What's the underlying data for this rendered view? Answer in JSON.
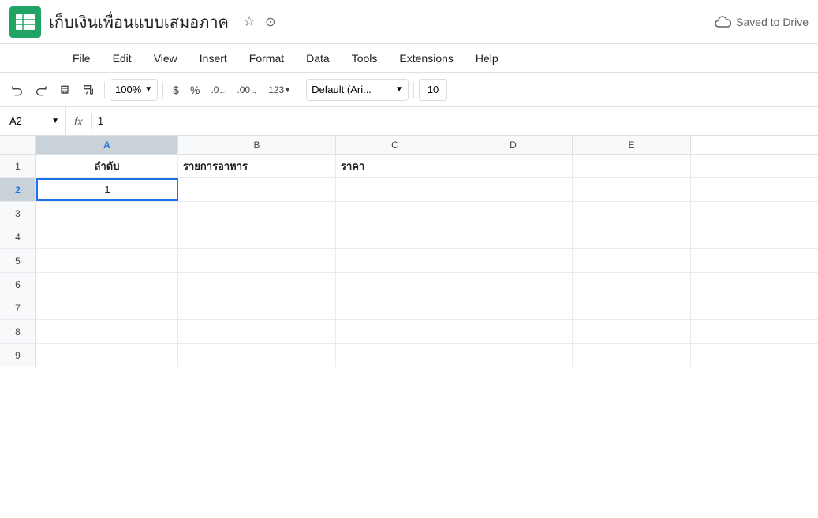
{
  "titleBar": {
    "docTitle": "เก็บเงินเพื่อนแบบเสมอภาค",
    "savedStatus": "Saved to Drive"
  },
  "menuBar": {
    "items": [
      "File",
      "Edit",
      "View",
      "Insert",
      "Format",
      "Data",
      "Tools",
      "Extensions",
      "Help"
    ]
  },
  "toolbar": {
    "zoomLevel": "100%",
    "dollarSign": "$",
    "percentSign": "%",
    "decimal0": ".0",
    "decimal00": ".00",
    "moreFormats": "123",
    "fontFamily": "Default (Ari...",
    "fontSize": "10"
  },
  "formulaBar": {
    "cellRef": "A2",
    "fxLabel": "fx",
    "formula": "1"
  },
  "columns": [
    "A",
    "B",
    "C",
    "D",
    "E"
  ],
  "rows": [
    {
      "rowNum": "1",
      "cells": [
        "ลำดับ",
        "รายการอาหาร",
        "ราคา",
        "",
        ""
      ]
    },
    {
      "rowNum": "2",
      "cells": [
        "1",
        "",
        "",
        "",
        ""
      ],
      "active": true
    },
    {
      "rowNum": "3",
      "cells": [
        "",
        "",
        "",
        "",
        ""
      ]
    },
    {
      "rowNum": "4",
      "cells": [
        "",
        "",
        "",
        "",
        ""
      ]
    },
    {
      "rowNum": "5",
      "cells": [
        "",
        "",
        "",
        "",
        ""
      ]
    },
    {
      "rowNum": "6",
      "cells": [
        "",
        "",
        "",
        "",
        ""
      ]
    },
    {
      "rowNum": "7",
      "cells": [
        "",
        "",
        "",
        "",
        ""
      ]
    },
    {
      "rowNum": "8",
      "cells": [
        "",
        "",
        "",
        "",
        ""
      ]
    },
    {
      "rowNum": "9",
      "cells": [
        "",
        "",
        "",
        "",
        ""
      ]
    }
  ]
}
